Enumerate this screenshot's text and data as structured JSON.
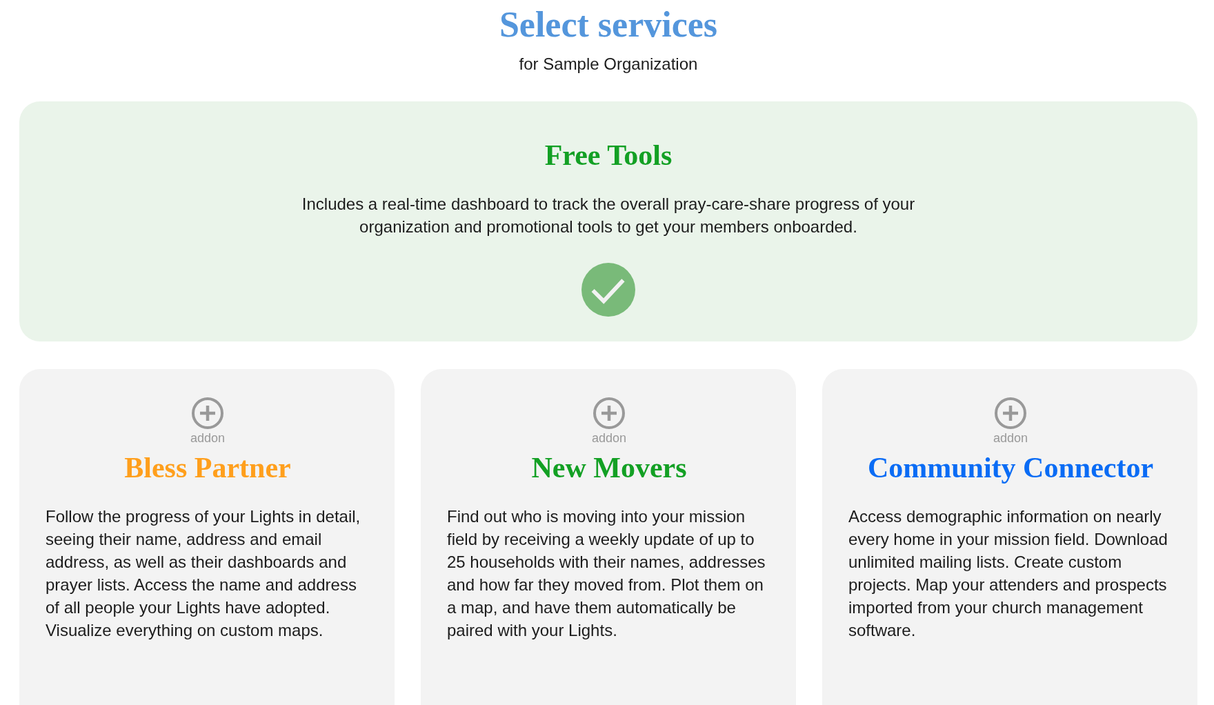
{
  "header": {
    "title": "Select services",
    "subtitle": "for Sample Organization"
  },
  "free_tools": {
    "title": "Free Tools",
    "description": "Includes a real-time dashboard to track the overall pray-care-share progress of your organization and promotional tools to get your members onboarded.",
    "selected": true
  },
  "addons": [
    {
      "label": "addon",
      "title": "Bless Partner",
      "color": "#ff9f1c",
      "selected": false,
      "description": "Follow the progress of your Lights in detail, seeing their name, address and email address, as well as their dashboards and prayer lists. Access the name and address of all people your Lights have adopted. Visualize everything on custom maps."
    },
    {
      "label": "addon",
      "title": "New Movers",
      "color": "#13a024",
      "selected": false,
      "description": "Find out who is moving into your mission field by receiving a weekly update of up to 25 households with their names, addresses and how far they moved from. Plot them on a map, and have them automatically be paired with your Lights."
    },
    {
      "label": "addon",
      "title": "Community Connector",
      "color": "#0a6cf5",
      "selected": false,
      "description": "Access demographic information on nearly every home in your mission field. Download unlimited mailing lists. Create custom projects. Map your attenders and prospects imported from your church management software."
    }
  ]
}
